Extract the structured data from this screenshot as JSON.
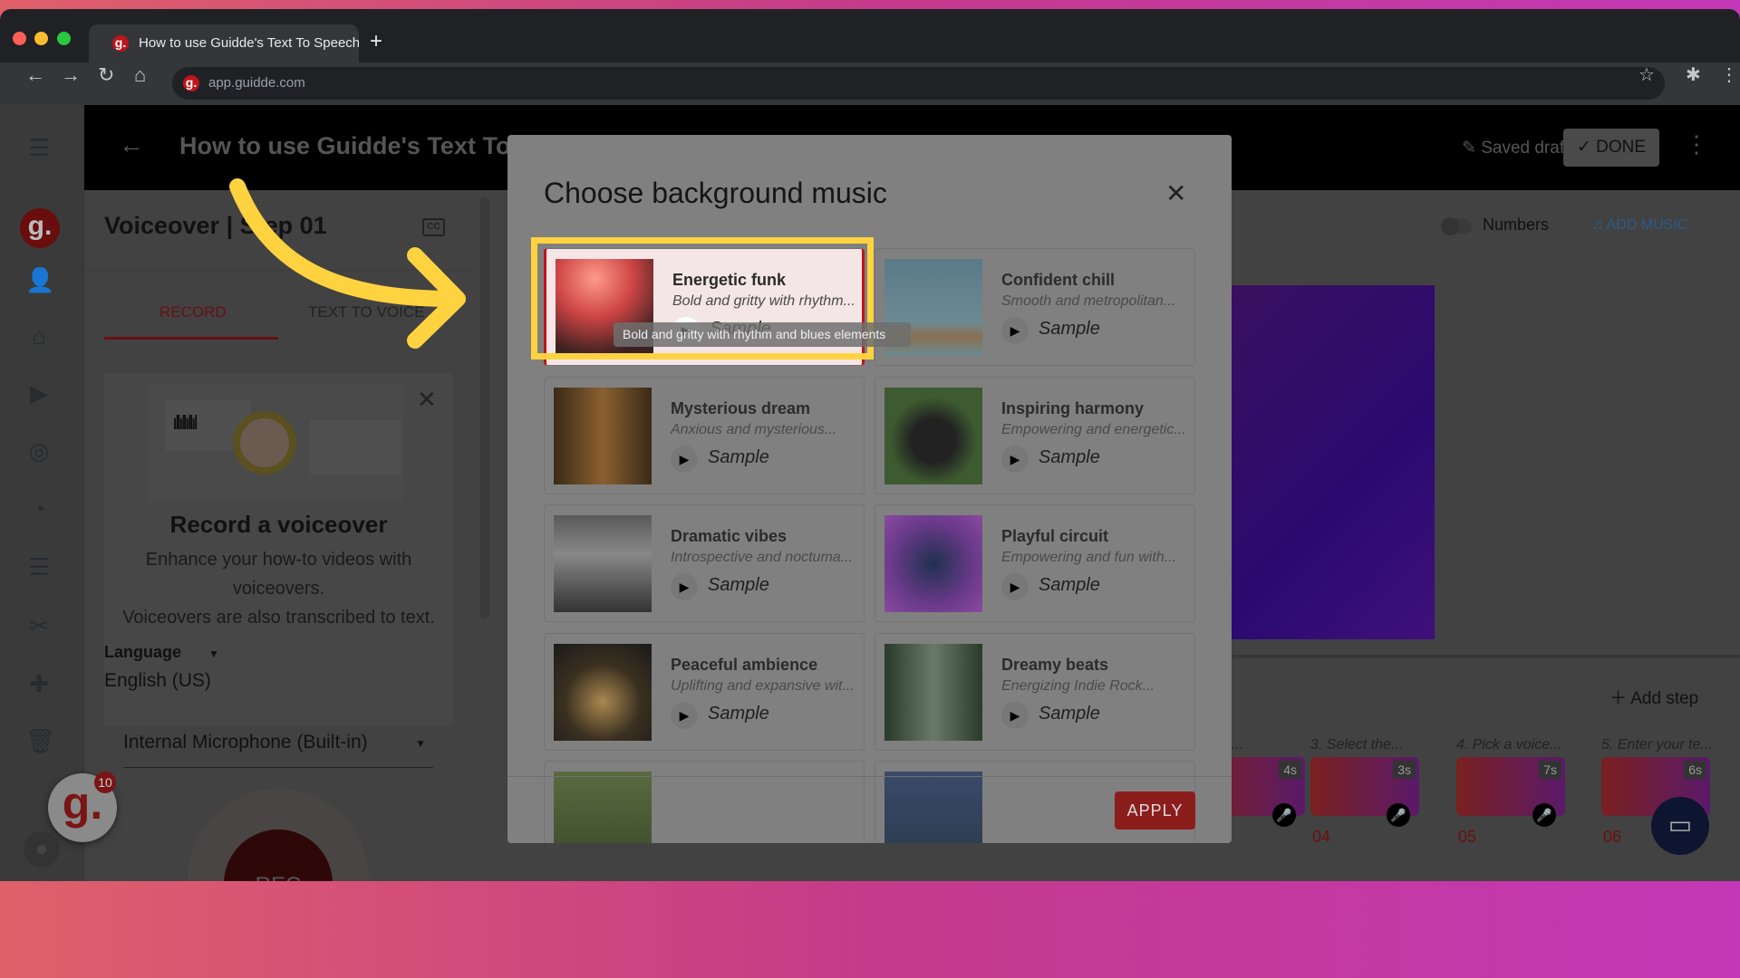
{
  "browser": {
    "tab_title": "How to use Guidde's Text To Speech feature",
    "url": "app.guidde.com",
    "favicon": "g."
  },
  "header": {
    "title": "How to use Guidde's Text To Speech feature",
    "saved": "Saved draft",
    "done": "DONE"
  },
  "sidebar": {
    "logo": "g.",
    "badge": "10"
  },
  "voiceover": {
    "title": "Voiceover | Step 01",
    "tabs": [
      "RECORD",
      "TEXT TO VOICE"
    ],
    "card_title": "Record a voiceover",
    "card_lines": [
      "Enhance your how-to videos with",
      "voiceovers.",
      "Voiceovers are also transcribed to text."
    ],
    "language_label": "Language",
    "language_value": "English (US)",
    "microphone": "Internal Microphone (Built-in)",
    "rec": "REC"
  },
  "right": {
    "numbers": "Numbers",
    "add_music": "ADD MUSIC",
    "add_step": "Add step",
    "steps": [
      {
        "label": "Text t...",
        "dur": "4s",
        "num": ""
      },
      {
        "label": "3. Select the...",
        "dur": "3s",
        "num": "04"
      },
      {
        "label": "4. Pick a voice...",
        "dur": "7s",
        "num": "05"
      },
      {
        "label": "5. Enter your te...",
        "dur": "6s",
        "num": "06"
      }
    ]
  },
  "modal": {
    "title": "Choose background music",
    "apply": "APPLY",
    "sample_label": "Sample",
    "tooltip": "Bold and gritty with rhythm and blues elements",
    "tracks": [
      {
        "title": "Energetic funk",
        "subtitle": "Bold and gritty with rhythm...",
        "selected": true
      },
      {
        "title": "Confident chill",
        "subtitle": "Smooth and metropolitan..."
      },
      {
        "title": "Mysterious dream",
        "subtitle": "Anxious and mysterious..."
      },
      {
        "title": "Inspiring harmony",
        "subtitle": "Empowering and energetic..."
      },
      {
        "title": "Dramatic vibes",
        "subtitle": "Introspective and noctuma..."
      },
      {
        "title": "Playful circuit",
        "subtitle": "Empowering and fun with..."
      },
      {
        "title": "Peaceful ambience",
        "subtitle": "Uplifting and expansive wit..."
      },
      {
        "title": "Dreamy beats",
        "subtitle": "Energizing Indie Rock..."
      },
      {
        "title": "",
        "subtitle": ""
      },
      {
        "title": "",
        "subtitle": ""
      }
    ]
  },
  "colors": {
    "highlight": "#ffd23f",
    "accent": "#b71c1c",
    "add_music": "#2c5a8a"
  }
}
